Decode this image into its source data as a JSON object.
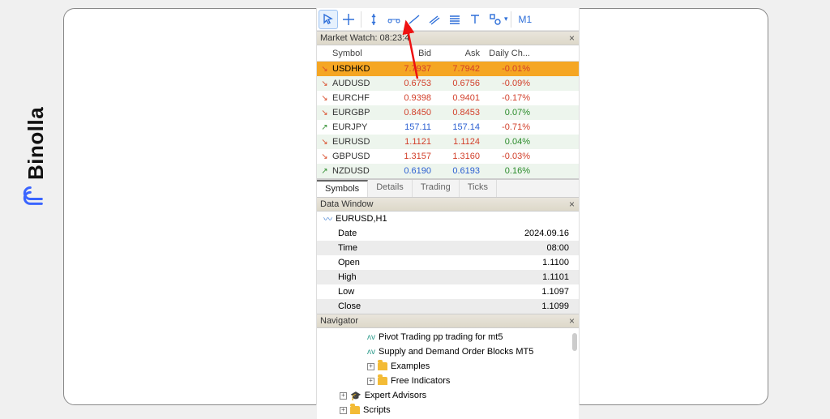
{
  "brand": {
    "name": "Binolla"
  },
  "toolbar": {
    "timeframe": "M1"
  },
  "market_watch": {
    "title": "Market Watch: 08:23:4",
    "headers": [
      "Symbol",
      "Bid",
      "Ask",
      "Daily Ch..."
    ],
    "rows": [
      {
        "dir": "dn",
        "sym": "USDHKD",
        "bid": "7.7937",
        "ask": "7.7942",
        "chg": "-0.01%",
        "sel": true,
        "bidc": "red",
        "askc": "red",
        "chgc": "red"
      },
      {
        "dir": "dn",
        "sym": "AUDUSD",
        "bid": "0.6753",
        "ask": "0.6756",
        "chg": "-0.09%",
        "alt": true,
        "bidc": "red",
        "askc": "red",
        "chgc": "red"
      },
      {
        "dir": "dn",
        "sym": "EURCHF",
        "bid": "0.9398",
        "ask": "0.9401",
        "chg": "-0.17%",
        "bidc": "red",
        "askc": "red",
        "chgc": "red"
      },
      {
        "dir": "dn",
        "sym": "EURGBP",
        "bid": "0.8450",
        "ask": "0.8453",
        "chg": "0.07%",
        "alt": true,
        "bidc": "red",
        "askc": "red",
        "chgc": "green"
      },
      {
        "dir": "up",
        "sym": "EURJPY",
        "bid": "157.11",
        "ask": "157.14",
        "chg": "-0.71%",
        "bidc": "blue",
        "askc": "blue",
        "chgc": "red"
      },
      {
        "dir": "dn",
        "sym": "EURUSD",
        "bid": "1.1121",
        "ask": "1.1124",
        "chg": "0.04%",
        "alt": true,
        "bidc": "red",
        "askc": "red",
        "chgc": "green"
      },
      {
        "dir": "dn",
        "sym": "GBPUSD",
        "bid": "1.3157",
        "ask": "1.3160",
        "chg": "-0.03%",
        "bidc": "red",
        "askc": "red",
        "chgc": "red"
      },
      {
        "dir": "up",
        "sym": "NZDUSD",
        "bid": "0.6190",
        "ask": "0.6193",
        "chg": "0.16%",
        "alt": true,
        "bidc": "blue",
        "askc": "blue",
        "chgc": "green"
      }
    ],
    "tabs": [
      "Symbols",
      "Details",
      "Trading",
      "Ticks"
    ]
  },
  "data_window": {
    "title": "Data Window",
    "symbol": "EURUSD,H1",
    "rows": [
      {
        "k": "Date",
        "v": "2024.09.16"
      },
      {
        "k": "Time",
        "v": "08:00"
      },
      {
        "k": "Open",
        "v": "1.1100"
      },
      {
        "k": "High",
        "v": "1.1101"
      },
      {
        "k": "Low",
        "v": "1.1097"
      },
      {
        "k": "Close",
        "v": "1.1099"
      }
    ]
  },
  "navigator": {
    "title": "Navigator",
    "items": [
      {
        "depth": 1,
        "icon": "ind",
        "label": "Pivot Trading pp trading for mt5"
      },
      {
        "depth": 1,
        "icon": "ind",
        "label": "Supply and Demand Order Blocks MT5"
      },
      {
        "depth": 1,
        "icon": "folder",
        "exp": true,
        "label": "Examples"
      },
      {
        "depth": 1,
        "icon": "folder",
        "exp": true,
        "label": "Free Indicators"
      },
      {
        "depth": 0,
        "icon": "ea",
        "exp": true,
        "label": "Expert Advisors"
      },
      {
        "depth": 0,
        "icon": "folder",
        "exp": true,
        "label": "Scripts"
      }
    ]
  }
}
